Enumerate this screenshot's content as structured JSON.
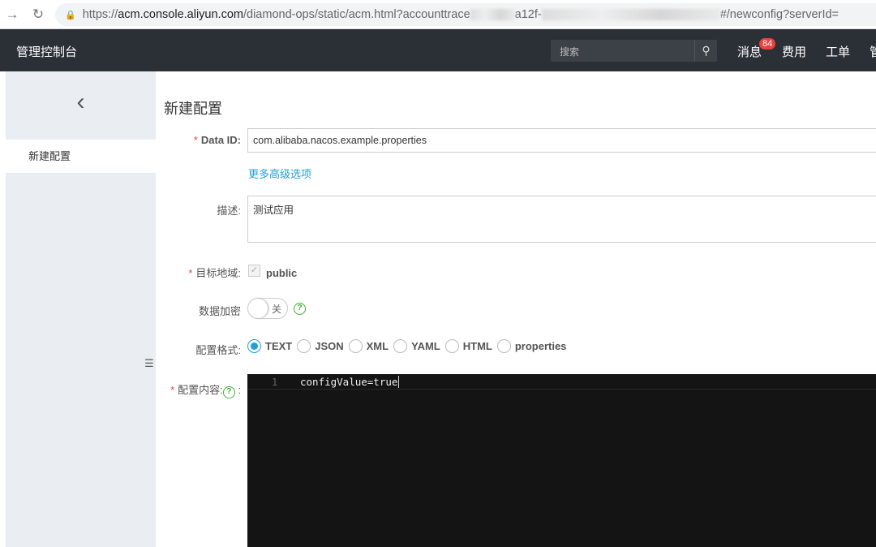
{
  "browser": {
    "url_prefix": "https://",
    "url_host": "acm.console.aliyun.com",
    "url_path": "/diamond-ops/static/acm.html?accounttrace",
    "url_mid": "a12f-",
    "url_tail": "#/newconfig?serverId="
  },
  "topbar": {
    "brand": "管理控制台",
    "search_placeholder": "搜索",
    "messages": "消息",
    "badge": "84",
    "fees": "费用",
    "tickets": "工单",
    "more": "管"
  },
  "sidebar": {
    "item": "新建配置"
  },
  "form": {
    "title": "新建配置",
    "data_id_label": "Data ID:",
    "data_id_value": "com.alibaba.nacos.example.properties",
    "advanced_link": "更多高级选项",
    "desc_label": "描述:",
    "desc_value": "测试应用",
    "region_label": "目标地域:",
    "region_value": "public",
    "encrypt_label": "数据加密",
    "encrypt_state": "关",
    "format_label": "配置格式:",
    "formats": [
      "TEXT",
      "JSON",
      "XML",
      "YAML",
      "HTML",
      "properties"
    ],
    "selected_format": "TEXT",
    "content_label": "配置内容:",
    "content_colon": ":",
    "line_number": "1",
    "content": "configValue=true"
  }
}
